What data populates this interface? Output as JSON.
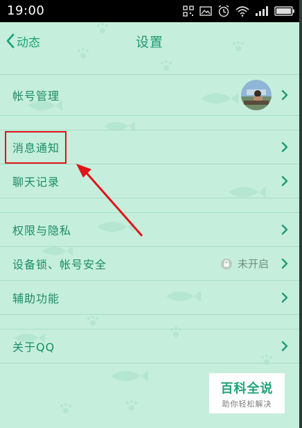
{
  "status_bar": {
    "time": "19:00",
    "icons": [
      "qr-icon",
      "image-icon",
      "alarm-icon",
      "wifi-icon",
      "signal-icon",
      "battery-icon"
    ]
  },
  "header": {
    "back_label": "动态",
    "title": "设置"
  },
  "settings": {
    "items": [
      {
        "label": "帐号管理"
      },
      {
        "label": "消息通知"
      },
      {
        "label": "聊天记录"
      },
      {
        "label": "权限与隐私"
      },
      {
        "label": "设备锁、帐号安全",
        "status": "未开启"
      },
      {
        "label": "辅助功能"
      },
      {
        "label": "关于QQ"
      }
    ]
  },
  "watermark": {
    "title": "百科全说",
    "subtitle": "助你轻松解决"
  },
  "colors": {
    "accent": "#1d9a74",
    "background": "#c6eedc",
    "highlight": "#e0131a"
  }
}
